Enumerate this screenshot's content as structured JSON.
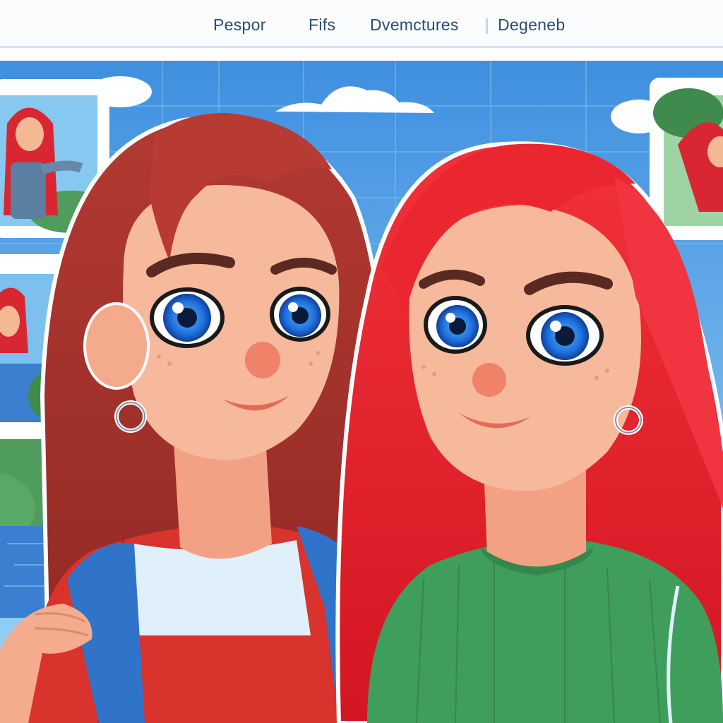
{
  "header": {
    "nav_items": [
      {
        "label": "Pespor"
      },
      {
        "label": "Fifs"
      },
      {
        "label": "Dvemctures"
      },
      {
        "label": "Degeneb"
      }
    ]
  },
  "gallery": {
    "thumbnails": [
      {
        "name": "redhead-girl-standing"
      },
      {
        "name": "redhead-girl-lake"
      },
      {
        "name": "redhead-girl-forest"
      }
    ]
  },
  "scene": {
    "sky_color": "#5aa6e8",
    "left_hair_color": "#a8322e",
    "right_hair_color": "#e8202a",
    "left_shirt_color": "#d9332e",
    "right_shirt_color": "#3f9e5c",
    "backpack_color": "#2f74c9"
  }
}
